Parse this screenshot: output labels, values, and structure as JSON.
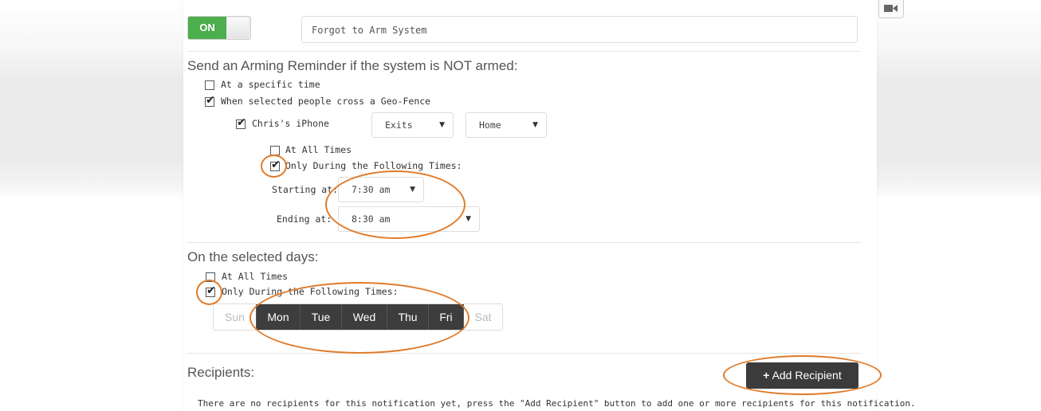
{
  "notification": {
    "toggle_label": "ON",
    "name_value": "Forgot to Arm System"
  },
  "reminder": {
    "heading": "Send an Arming Reminder if the system is NOT armed:",
    "opt_specific_time": "At a specific time",
    "opt_geofence": "When selected people cross a Geo-Fence",
    "device_label": "Chris's iPhone",
    "action_select": "Exits",
    "location_select": "Home",
    "at_all_times": "At All Times",
    "only_during": "Only During the Following Times:",
    "starting_label": "Starting at:",
    "starting_value": "7:30 am",
    "ending_label": "Ending at:",
    "ending_value": "8:30 am"
  },
  "days_section": {
    "heading": "On the selected days:",
    "at_all_times": "At All Times",
    "only_during": "Only During the Following Times:",
    "days": [
      {
        "label": "Sun",
        "selected": false
      },
      {
        "label": "Mon",
        "selected": true
      },
      {
        "label": "Tue",
        "selected": true
      },
      {
        "label": "Wed",
        "selected": true
      },
      {
        "label": "Thu",
        "selected": true
      },
      {
        "label": "Fri",
        "selected": true
      },
      {
        "label": "Sat",
        "selected": false
      }
    ]
  },
  "recipients": {
    "heading": "Recipients:",
    "add_button": "Add Recipient",
    "add_icon": "+",
    "empty_message": "There are no recipients for this notification yet, press the \"Add Recipient\" button to add one or more recipients for this notification."
  },
  "icons": {
    "camera": "video-camera-icon",
    "select_arrow": "▼"
  },
  "colors": {
    "on_green": "#4cae4c",
    "highlight_orange": "#e07b2a",
    "day_selected": "#3d3d3d",
    "button_dark": "#3b3b3b"
  }
}
